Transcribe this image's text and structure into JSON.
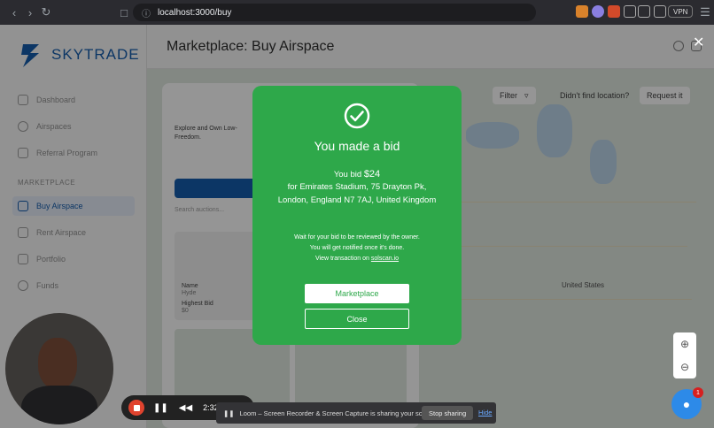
{
  "browser": {
    "url": "localhost:3000/buy",
    "vpn_label": "VPN"
  },
  "sidebar": {
    "logo_text": "SKYTRADE",
    "items": [
      {
        "label": "Dashboard"
      },
      {
        "label": "Airspaces"
      },
      {
        "label": "Referral Program"
      }
    ],
    "section_label": "MARKETPLACE",
    "marketplace_items": [
      {
        "label": "Buy Airspace",
        "active": true
      },
      {
        "label": "Rent Airspace"
      },
      {
        "label": "Portfolio"
      },
      {
        "label": "Funds"
      }
    ]
  },
  "header": {
    "title": "Marketplace: Buy Airspace"
  },
  "panel": {
    "intro": "Explore and Own Low-",
    "intro2": "Freedom.",
    "search_placeholder": "Search auctions...",
    "card_name_label": "Name",
    "card_name_value": "Hyde",
    "card_bid_label": "Highest Bid",
    "card_bid_value": "$0"
  },
  "map": {
    "filter_label": "Filter",
    "find_label": "Didn't find location?",
    "request_label": "Request it",
    "country_label": "United States"
  },
  "modal": {
    "title": "You made a bid",
    "bid_prefix": "You bid ",
    "bid_amount": "$24",
    "location_line1": "for Emirates Stadium, 75 Drayton Pk,",
    "location_line2": "London, England N7 7AJ, United Kingdom",
    "info_line1": "Wait for your bid to be reviewed by the owner.",
    "info_line2": "You will get notified once it's done.",
    "info_line3_prefix": "View transaction on ",
    "info_link": "solscan.io",
    "marketplace_button": "Marketplace",
    "close_button": "Close"
  },
  "loom": {
    "timer": "2:32",
    "share_text": "Loom – Screen Recorder & Screen Capture is sharing your screen.",
    "stop_sharing": "Stop sharing",
    "hide": "Hide"
  },
  "chat": {
    "badge": "1"
  },
  "colors": {
    "modal_green": "#2ea84a",
    "brand_blue": "#0653a8",
    "record_red": "#e0432e"
  }
}
